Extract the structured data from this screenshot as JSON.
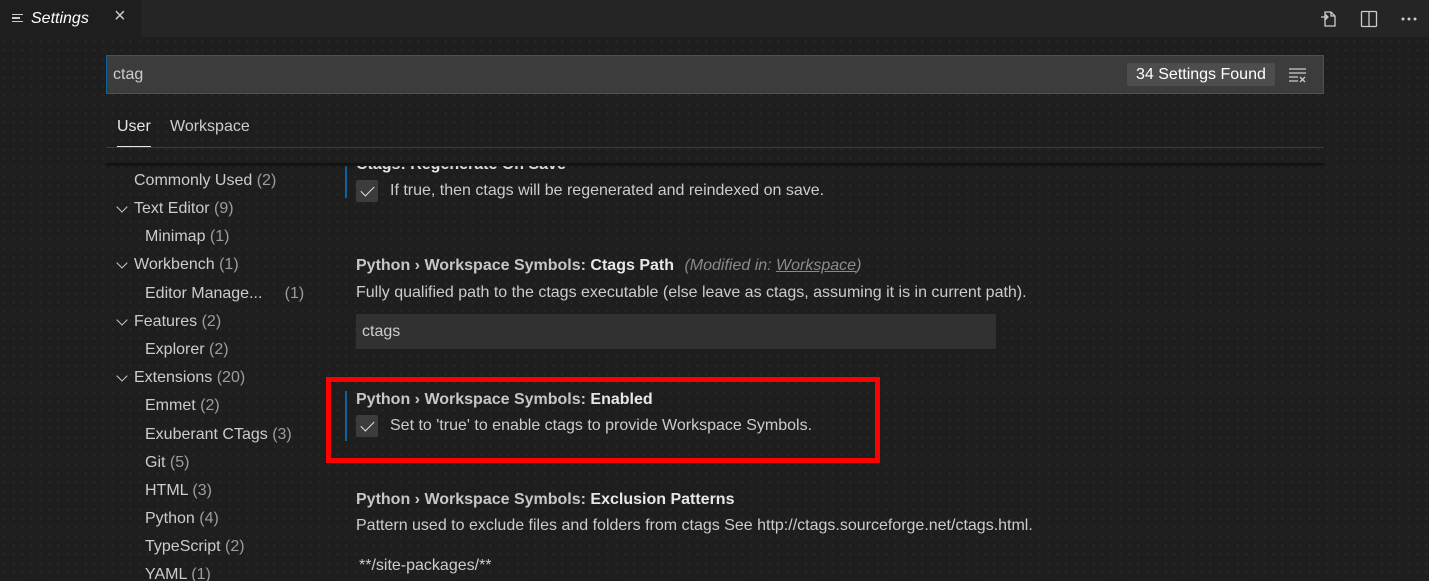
{
  "tab": {
    "title": "Settings",
    "close_glyph": "×",
    "icons": [
      "menu-icon",
      "close-icon",
      "open-json-icon",
      "split-editor-icon",
      "more-actions-icon"
    ]
  },
  "search": {
    "value": "ctag",
    "results_count": "34 Settings Found"
  },
  "scopes": {
    "user": "User",
    "workspace": "Workspace"
  },
  "toc": [
    {
      "label": "Commonly Used",
      "count": "(2)"
    },
    {
      "label": "Text Editor",
      "count": "(9)"
    },
    {
      "label": "Minimap",
      "count": "(1)"
    },
    {
      "label": "Workbench",
      "count": "(1)"
    },
    {
      "label": "Editor Manage...",
      "count": "(1)"
    },
    {
      "label": "Features",
      "count": "(2)"
    },
    {
      "label": "Explorer",
      "count": "(2)"
    },
    {
      "label": "Extensions",
      "count": "(20)"
    },
    {
      "label": "Emmet",
      "count": "(2)"
    },
    {
      "label": "Exuberant CTags",
      "count": "(3)"
    },
    {
      "label": "Git",
      "count": "(5)"
    },
    {
      "label": "HTML",
      "count": "(3)"
    },
    {
      "label": "Python",
      "count": "(4)"
    },
    {
      "label": "TypeScript",
      "count": "(2)"
    },
    {
      "label": "YAML",
      "count": "(1)"
    }
  ],
  "settings": {
    "regenerate": {
      "title": "Ctags: Regenerate On Save",
      "description": "If true, then ctags will be regenerated and reindexed on save.",
      "checked": true
    },
    "ctags_path": {
      "category": "Python › Workspace Symbols: ",
      "key": "Ctags Path",
      "modified_prefix": "(Modified in: ",
      "modified_link": "Workspace",
      "modified_suffix": ")",
      "description": "Fully qualified path to the ctags executable (else leave as ctags, assuming it is in current path).",
      "value": "ctags"
    },
    "enabled": {
      "category": "Python › Workspace Symbols: ",
      "key": "Enabled",
      "description": "Set to 'true' to enable ctags to provide Workspace Symbols.",
      "checked": true
    },
    "exclusion": {
      "category": "Python › Workspace Symbols: ",
      "key": "Exclusion Patterns",
      "description": "Pattern used to exclude files and folders from ctags See http://ctags.sourceforge.net/ctags.html.",
      "first_item": "**/site-packages/**"
    }
  },
  "colors": {
    "highlight_border": "#ff0000",
    "focus_border": "#0e639c"
  }
}
